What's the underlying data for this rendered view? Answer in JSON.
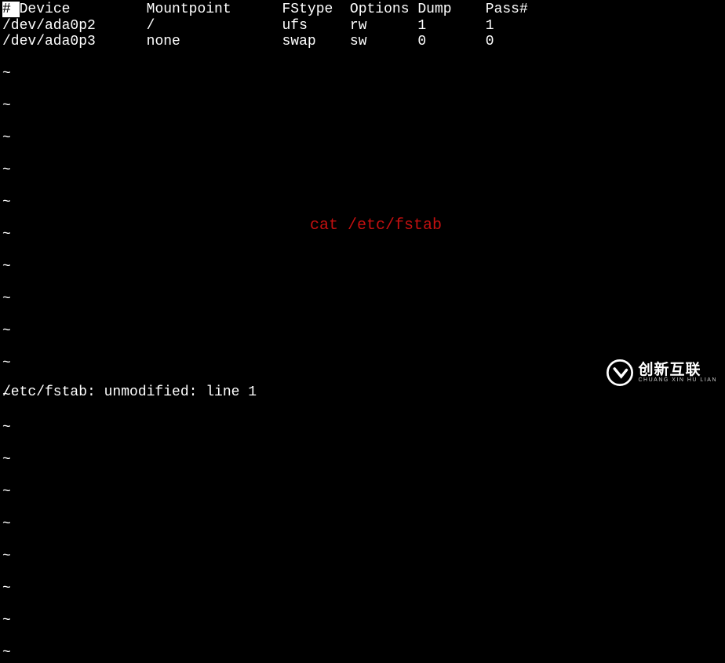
{
  "header": {
    "col1": "# ",
    "col2": "Device",
    "col3": "Mountpoint",
    "col4": "FStype",
    "col5": "Options",
    "col6": "Dump",
    "col7": "Pass#"
  },
  "rows": [
    {
      "device": "/dev/ada0p2",
      "mountpoint": "/",
      "fstype": "ufs",
      "options": "rw",
      "dump": "1",
      "pass": "1"
    },
    {
      "device": "/dev/ada0p3",
      "mountpoint": "none",
      "fstype": "swap",
      "options": "sw",
      "dump": "0",
      "pass": "0"
    }
  ],
  "tilde": "~",
  "overlay": "cat /etc/fstab",
  "status": "/etc/fstab: unmodified: line 1",
  "watermark": {
    "main": "创新互联",
    "sub": "CHUANG XIN HU LIAN"
  }
}
